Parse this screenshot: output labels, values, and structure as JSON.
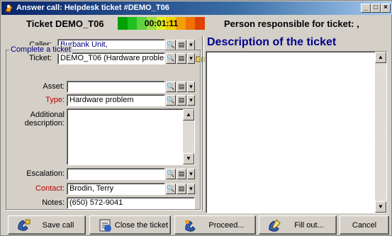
{
  "window": {
    "title": "Answer call: Helpdesk ticket #DEMO_T06"
  },
  "header": {
    "ticket_label": "Ticket DEMO_T06",
    "timer": "00:01:11",
    "responsible": "Person responsible for ticket: ,"
  },
  "caller": {
    "label": "Caller:",
    "value": "Burbank Unit,"
  },
  "ticket": {
    "label": "Ticket:",
    "value": "DEMO_T06 (Hardware problem"
  },
  "complete": {
    "title": "Complete a ticket",
    "asset_label": "Asset:",
    "asset_value": "",
    "type_label": "Type:",
    "type_value": "Hardware problem",
    "additional_label_1": "Additional",
    "additional_label_2": "description:",
    "additional_value": "",
    "escalation_label": "Escalation:",
    "escalation_value": "",
    "contact_label": "Contact:",
    "contact_value": "Brodin, Terry",
    "notes_label": "Notes:",
    "notes_value": "(650) 572-9041"
  },
  "description": {
    "title": "Description of the ticket",
    "value": ""
  },
  "buttons": {
    "save_call": "Save call",
    "close_ticket": "Close the ticket",
    "proceed": "Proceed...",
    "fill_out": "Fill out...",
    "cancel": "Cancel"
  },
  "colors": {
    "title_start": "#0a246a",
    "title_end": "#a6caf0",
    "desc_title": "#00008b",
    "label_red": "#c00000"
  }
}
